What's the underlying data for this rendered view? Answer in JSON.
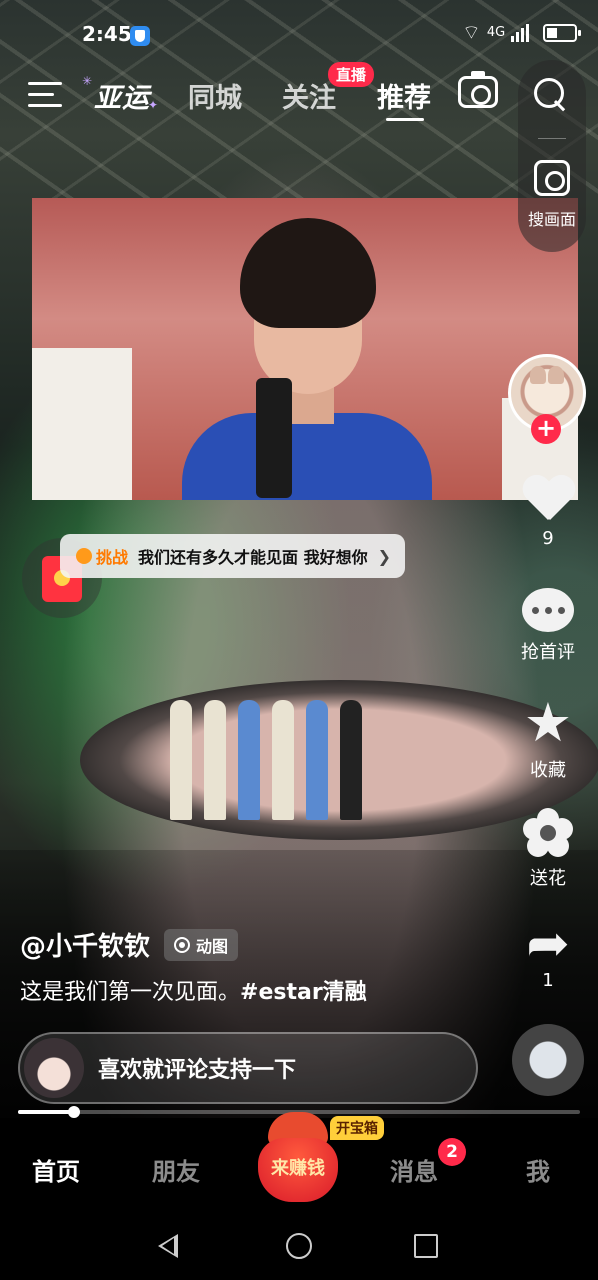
{
  "status_bar": {
    "time": "2:45",
    "network": "4G"
  },
  "top_nav": {
    "tabs": [
      {
        "label": "亚运",
        "active": false
      },
      {
        "label": "同城",
        "active": false
      },
      {
        "label": "关注",
        "active": false
      },
      {
        "label": "推荐",
        "active": true
      }
    ],
    "live_badge": "直播"
  },
  "search_panel": {
    "scan_label": "搜画面"
  },
  "right_rail": {
    "like_count": "9",
    "comment_label": "抢首评",
    "favorite_label": "收藏",
    "gift_label": "送花",
    "share_count": "1"
  },
  "challenge": {
    "tag": "挑战",
    "text": "我们还有多久才能见面 我好想你"
  },
  "post": {
    "author": "@小千钦钦",
    "gif_badge": "动图",
    "caption_text": "这是我们第一次见面。",
    "hashtag": "#estar清融"
  },
  "comment_bar": {
    "prompt": "喜欢就评论支持一下"
  },
  "playback": {
    "progress": 0.1
  },
  "bottom_tabs": {
    "home": "首页",
    "friends": "朋友",
    "earn": "来赚钱",
    "chest_badge": "开宝箱",
    "messages": "消息",
    "messages_badge": "2",
    "me": "我"
  },
  "colors": {
    "accent": "#ff2a4a",
    "chest": "#ffcf3a"
  }
}
